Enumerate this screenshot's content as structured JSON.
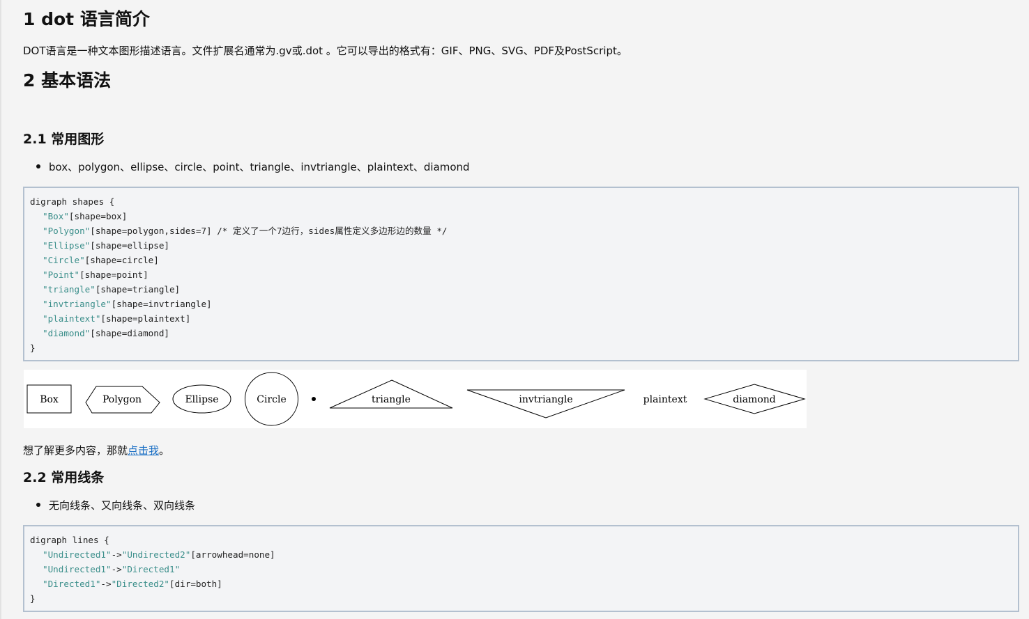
{
  "sections": {
    "s1_title": "1 dot 语言简介",
    "s1_para": "DOT语言是一种文本图形描述语言。文件扩展名通常为.gv或.dot 。它可以导出的格式有：GIF、PNG、SVG、PDF及PostScript。",
    "s2_title": "2 基本语法",
    "s21_title": "2.1 常用图形",
    "s21_bullet": "box、polygon、ellipse、circle、point、triangle、invtriangle、plaintext、diamond",
    "s21_more_prefix": "想了解更多内容，那就",
    "s21_more_link": "点击我",
    "s21_more_suffix": "。",
    "s22_title": "2.2 常用线条",
    "s22_bullet": "无向线条、又向线条、双向线条"
  },
  "code_shapes": {
    "open": "digraph shapes {",
    "lines": [
      {
        "name": "\"Box\"",
        "attr": "[shape=box]",
        "comment": ""
      },
      {
        "name": "\"Polygon\"",
        "attr": "[shape=polygon,sides=7]",
        "comment": " /* 定义了一个7边行，sides属性定义多边形边的数量 */"
      },
      {
        "name": "\"Ellipse\"",
        "attr": "[shape=ellipse]",
        "comment": ""
      },
      {
        "name": "\"Circle\"",
        "attr": "[shape=circle]",
        "comment": ""
      },
      {
        "name": "\"Point\"",
        "attr": "[shape=point]",
        "comment": ""
      },
      {
        "name": "\"triangle\"",
        "attr": "[shape=triangle]",
        "comment": ""
      },
      {
        "name": "\"invtriangle\"",
        "attr": "[shape=invtriangle]",
        "comment": ""
      },
      {
        "name": "\"plaintext\"",
        "attr": "[shape=plaintext]",
        "comment": ""
      },
      {
        "name": "\"diamond\"",
        "attr": "[shape=diamond]",
        "comment": ""
      }
    ],
    "close": "}"
  },
  "graph_labels": {
    "box": "Box",
    "polygon": "Polygon",
    "ellipse": "Ellipse",
    "circle": "Circle",
    "triangle": "triangle",
    "invtriangle": "invtriangle",
    "plaintext": "plaintext",
    "diamond": "diamond"
  },
  "code_lines": {
    "open": "digraph lines {",
    "l1_a": "\"Undirected1\"",
    "l1_op": "->",
    "l1_b": "\"Undirected2\"",
    "l1_attr": "[arrowhead=none]",
    "l2_a": "\"Undirected1\"",
    "l2_op": "->",
    "l2_b": "\"Directed1\"",
    "l3_a": "\"Directed1\"",
    "l3_op": "->",
    "l3_b": "\"Directed2\"",
    "l3_attr": "[dir=both]",
    "close": "}"
  }
}
